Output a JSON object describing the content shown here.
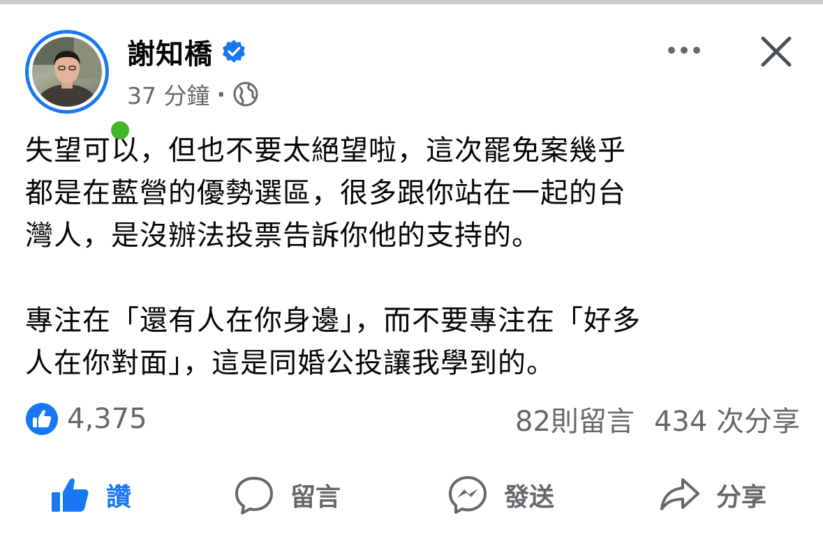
{
  "post": {
    "author": "謝知橋",
    "time": "37 分鐘",
    "separator": "·",
    "body": [
      [
        "失望可以，但也不要太絕望啦，這次罷免案幾乎",
        "都是在藍營的優勢選區，很多跟你站在一起的台",
        "灣人，是沒辦法投票告訴你他的支持的。"
      ],
      [
        "專注在「還有人在你身邊」，而不要專注在「好多",
        "人在你對面」，這是同婚公投讓我學到的。"
      ]
    ]
  },
  "stats": {
    "likes": "4,375",
    "comments": "82則留言",
    "shares": "434 次分享"
  },
  "actions": {
    "like": "讚",
    "comment": "留言",
    "send": "發送",
    "share": "分享"
  },
  "icons": {
    "verified": "verified-badge-icon",
    "audience": "globe-icon",
    "more": "more-options-icon",
    "close": "close-icon",
    "like_badge": "thumbs-up-badge-icon"
  },
  "colors": {
    "accent": "#1877f2",
    "online": "#42b72a",
    "secondary_text": "#65676b"
  }
}
